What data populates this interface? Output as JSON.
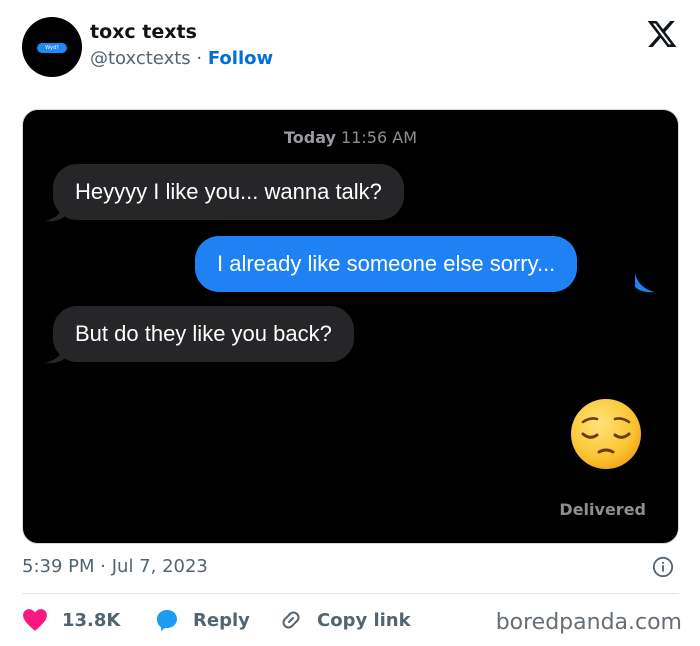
{
  "author": {
    "name": "toxc texts",
    "handle": "@toxctexts",
    "separator": "·",
    "follow_label": "Follow",
    "avatar_text": "Wyd?"
  },
  "platform_icon": "x-logo-icon",
  "conversation": {
    "timestamp_day": "Today",
    "timestamp_time": "11:56 AM",
    "messages": [
      {
        "direction": "incoming",
        "text": "Heyyyy I like you... wanna talk?"
      },
      {
        "direction": "outgoing",
        "text": "I already like someone else sorry..."
      },
      {
        "direction": "incoming",
        "text": "But do they like you back?"
      }
    ],
    "emoji": "pensive-face-emoji",
    "status": "Delivered"
  },
  "post_meta": {
    "time": "5:39 PM",
    "separator": "·",
    "date": "Jul 7, 2023"
  },
  "actions": {
    "like_count": "13.8K",
    "reply_label": "Reply",
    "copy_link_label": "Copy link"
  },
  "watermark": "boredpanda.com",
  "colors": {
    "like": "#f91880",
    "reply": "#1d9bf0",
    "outgoing_bubble": "#1e82f5",
    "incoming_bubble": "#262628",
    "follow": "#006fd6"
  }
}
